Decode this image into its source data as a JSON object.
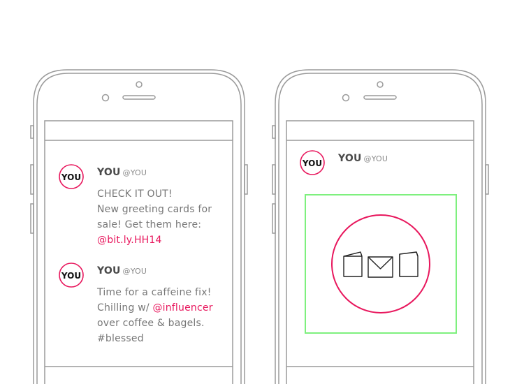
{
  "colors": {
    "accent": "#e8175d",
    "outline": "#9a9a9a",
    "text": "#777777",
    "highlight_box": "#7ef07e"
  },
  "left_phone": {
    "posts": [
      {
        "avatar_label": "YOU",
        "name": "YOU",
        "handle": "@YOU",
        "lines": [
          "CHECK IT OUT!",
          "New greeting cards for",
          "sale!  Get them here:"
        ],
        "link": "@bit.ly.HH14"
      },
      {
        "avatar_label": "YOU",
        "name": "YOU",
        "handle": "@YOU",
        "line1": "Time for a caffeine fix!",
        "line2_prefix": "Chilling w/ ",
        "line2_link": "@influencer",
        "line3": "over coffee & bagels.",
        "line4": "#blessed"
      }
    ]
  },
  "right_phone": {
    "post": {
      "avatar_label": "YOU",
      "name": "YOU",
      "handle": "@YOU",
      "image_icon": "greeting-cards-envelope-icon"
    }
  }
}
